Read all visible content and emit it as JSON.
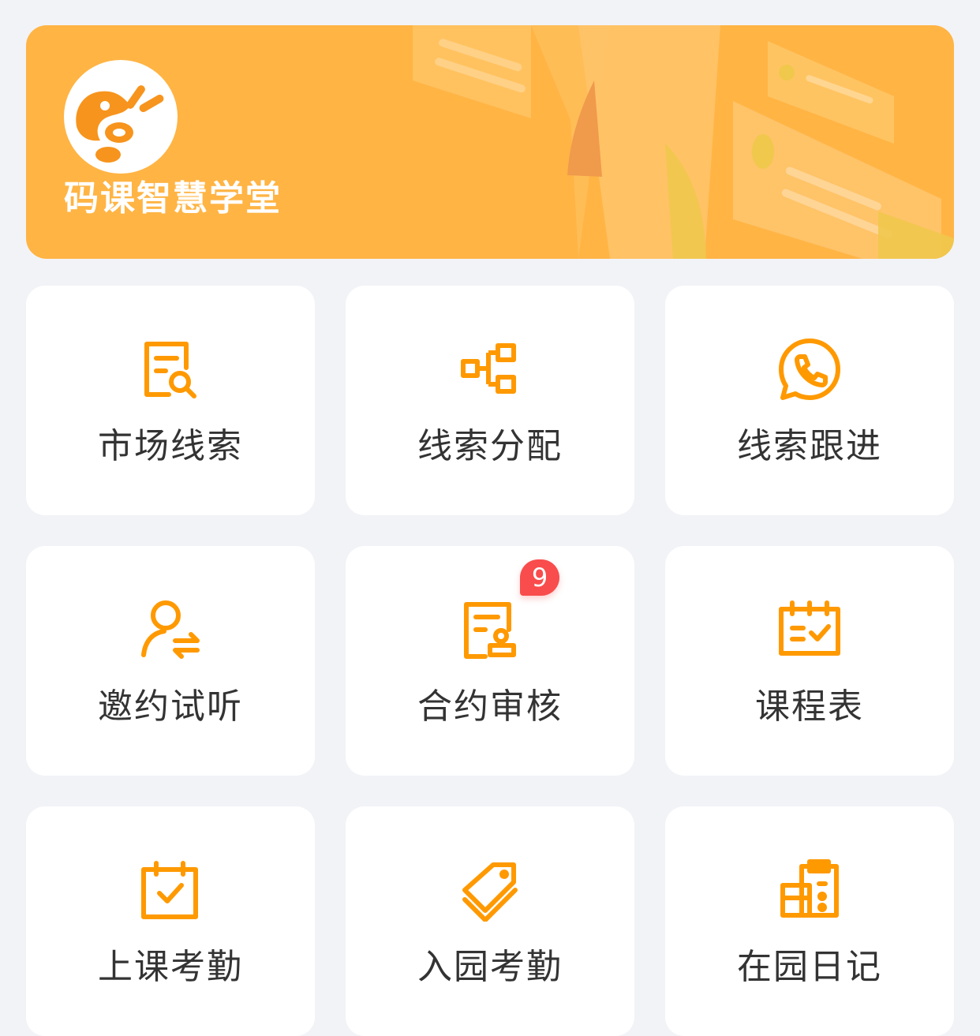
{
  "colors": {
    "accent": "#ff9900",
    "banner": "#ffb444",
    "badge": "#f94c4c",
    "background": "#f2f3f7",
    "card": "#ffffff",
    "text": "#333333"
  },
  "banner": {
    "brand_name": "码课智慧学堂",
    "logo_icon": "shrimp-logo-icon"
  },
  "menu": [
    {
      "label": "市场线索",
      "icon": "document-search-icon"
    },
    {
      "label": "线索分配",
      "icon": "hierarchy-icon"
    },
    {
      "label": "线索跟进",
      "icon": "phone-chat-icon"
    },
    {
      "label": "邀约试听",
      "icon": "user-exchange-icon"
    },
    {
      "label": "合约审核",
      "icon": "contract-stamp-icon",
      "badge": "9"
    },
    {
      "label": "课程表",
      "icon": "schedule-calendar-icon"
    },
    {
      "label": "上课考勤",
      "icon": "calendar-check-icon"
    },
    {
      "label": "入园考勤",
      "icon": "tag-stack-icon"
    },
    {
      "label": "在园日记",
      "icon": "clipboard-diary-icon"
    }
  ]
}
